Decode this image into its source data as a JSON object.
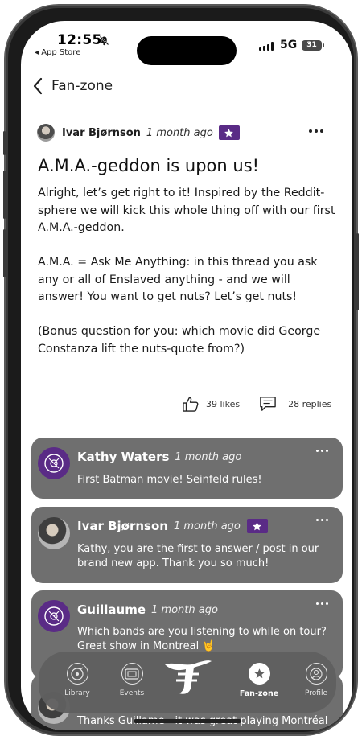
{
  "status_bar": {
    "time": "12:55",
    "back_app": "◂ App Store",
    "network": "5G",
    "battery": "31"
  },
  "nav": {
    "title": "Fan-zone"
  },
  "post": {
    "author": "Ivar Bjørnson",
    "time": "1 month ago",
    "title": "A.M.A.-geddon is upon us!",
    "paragraphs": [
      "Alright, let’s get right to it! Inspired by the Reddit-sphere we will kick this whole thing off with our first A.M.A.-geddon.",
      "A.M.A. = Ask Me Anything: in this thread you ask any or all of Enslaved anything - and we will answer! You want to get nuts? Let’s get nuts!",
      "(Bonus question for you: which movie did George Constanza lift the nuts-quote from?)"
    ],
    "likes": "39 likes",
    "replies": "28 replies"
  },
  "comments": [
    {
      "author": "Kathy Waters",
      "time": "1 month ago",
      "text": "First Batman movie! Seinfeld rules!"
    },
    {
      "author": "Ivar Bjørnson",
      "time": "1 month ago",
      "text": "Kathy,  you are the first to answer / post in our brand new app. Thank you so much!"
    },
    {
      "author": "Guillaume",
      "time": "1 month ago",
      "text": "Which bands are you listening to while on tour? Great show in Montreal 🤘"
    },
    {
      "author": "",
      "time": "",
      "text": "Thanks Guillame - it was great playing Montréal"
    }
  ],
  "tabs": [
    {
      "label": "Library"
    },
    {
      "label": "Events"
    },
    {
      "label": ""
    },
    {
      "label": "Fan-zone"
    },
    {
      "label": "Profile"
    }
  ],
  "colors": {
    "accent_purple": "#5a2b86",
    "comment_bg": "#6f6f6f",
    "tabbar_bg": "#606060"
  },
  "icons": [
    "back-chevron-icon",
    "bell-slash-icon",
    "star-icon",
    "thumbs-up-icon",
    "comment-icon",
    "more-dots-icon",
    "vinyl-icon",
    "ticket-icon",
    "brand-logo-icon",
    "fanzone-star-icon",
    "profile-icon"
  ]
}
